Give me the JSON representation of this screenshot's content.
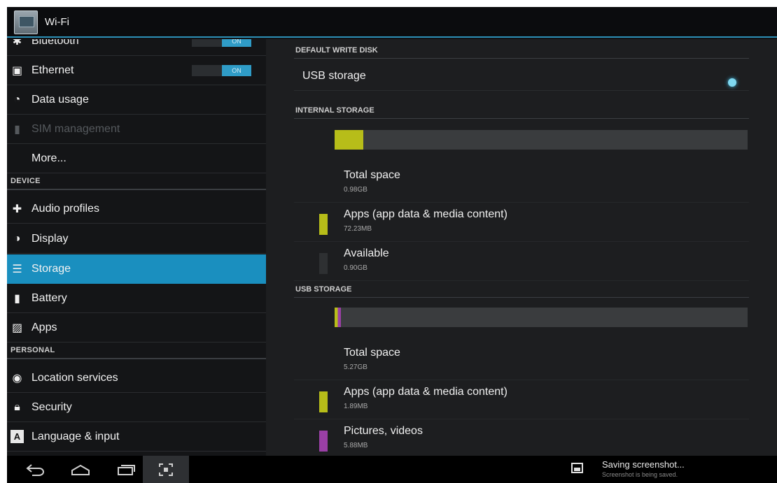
{
  "topbar": {
    "title": "Wi-Fi"
  },
  "sidebar": {
    "items": [
      {
        "label": "Bluetooth",
        "icon": "bluetooth-icon",
        "toggle": "ON"
      },
      {
        "label": "Ethernet",
        "icon": "ethernet-icon",
        "toggle": "ON"
      },
      {
        "label": "Data usage",
        "icon": "data-usage-icon"
      },
      {
        "label": "SIM management",
        "icon": "sim-icon",
        "disabled": true
      },
      {
        "label": "More...",
        "icon": ""
      }
    ],
    "section_device": "DEVICE",
    "device_items": [
      {
        "label": "Audio profiles",
        "icon": "audio-icon"
      },
      {
        "label": "Display",
        "icon": "display-icon"
      },
      {
        "label": "Storage",
        "icon": "storage-icon",
        "selected": true
      },
      {
        "label": "Battery",
        "icon": "battery-icon"
      },
      {
        "label": "Apps",
        "icon": "apps-icon"
      }
    ],
    "section_personal": "PERSONAL",
    "personal_items": [
      {
        "label": "Location services",
        "icon": "location-icon"
      },
      {
        "label": "Security",
        "icon": "lock-icon"
      },
      {
        "label": "Language & input",
        "icon": "language-icon"
      }
    ]
  },
  "storage": {
    "default_write_disk_header": "DEFAULT WRITE DISK",
    "default_write_disk_option": "USB storage",
    "internal_header": "INTERNAL STORAGE",
    "internal": {
      "used_fraction": 0.07,
      "total_label": "Total space",
      "total_value": "0.98GB",
      "apps_label": "Apps (app data & media content)",
      "apps_value": "72.23MB",
      "available_label": "Available",
      "available_value": "0.90GB"
    },
    "usb_header": "USB STORAGE",
    "usb": {
      "used_fraction": 0.015,
      "total_label": "Total space",
      "total_value": "5.27GB",
      "apps_label": "Apps (app data & media content)",
      "apps_value": "1.89MB",
      "pictures_label": "Pictures, videos",
      "pictures_value": "5.88MB"
    },
    "colors": {
      "apps": "#b7bd19",
      "pictures": "#9a3fa6",
      "available": "#2e3032",
      "accent": "#1a8fbf"
    }
  },
  "notification": {
    "title": "Saving screenshot...",
    "subtitle": "Screenshot is being saved."
  }
}
